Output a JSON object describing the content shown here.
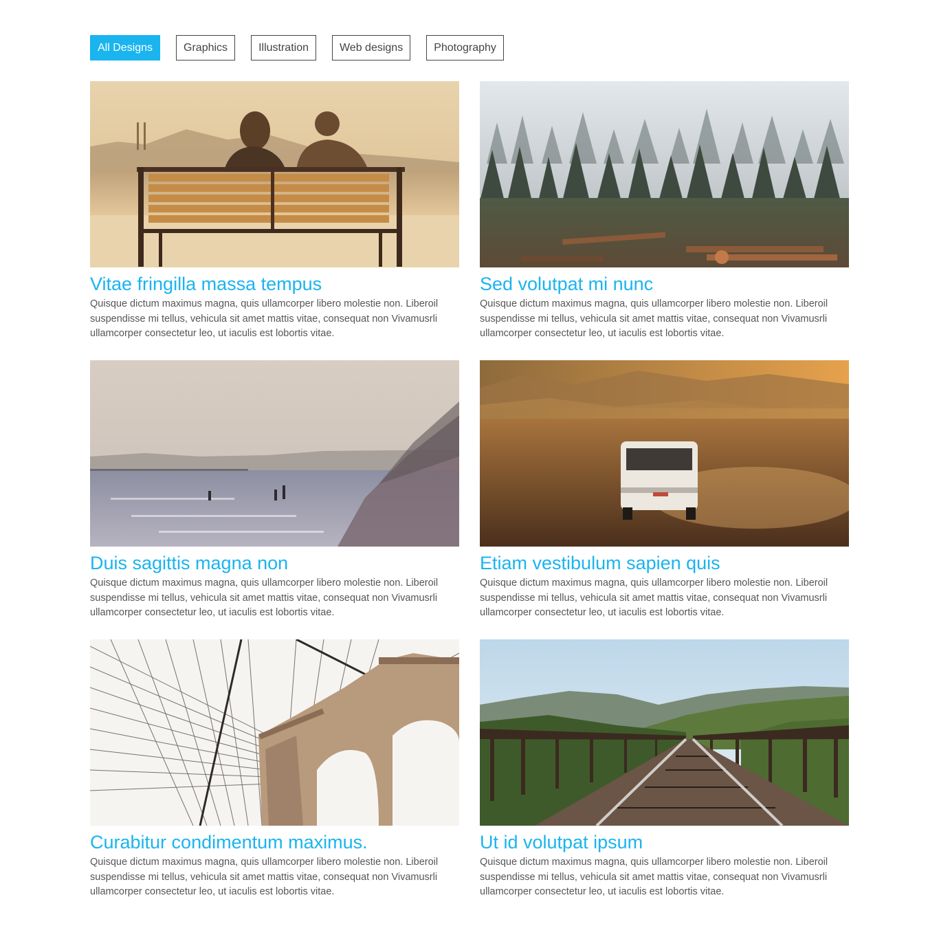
{
  "filters": [
    {
      "label": "All Designs",
      "active": true
    },
    {
      "label": "Graphics",
      "active": false
    },
    {
      "label": "Illustration",
      "active": false
    },
    {
      "label": "Web designs",
      "active": false
    },
    {
      "label": "Photography",
      "active": false
    }
  ],
  "colors": {
    "accent": "#1ab4ef",
    "text": "#555555",
    "border": "#444444"
  },
  "cards": [
    {
      "title": "Vitae fringilla massa tempus",
      "text": "Quisque dictum maximus magna, quis ullamcorper libero molestie non. Liberoil suspendisse mi tellus, vehicula sit amet mattis vitae, consequat non Vivamusrli ullamcorper consectetur leo, ut iaculis est lobortis vitae.",
      "image": "couple-on-bench-photo"
    },
    {
      "title": "Sed volutpat mi nunc",
      "text": "Quisque dictum maximus magna, quis ullamcorper libero molestie non. Liberoil suspendisse mi tellus, vehicula sit amet mattis vitae, consequat non Vivamusrli ullamcorper consectetur leo, ut iaculis est lobortis vitae.",
      "image": "foggy-forest-photo"
    },
    {
      "title": "Duis sagittis magna non",
      "text": "Quisque dictum maximus magna, quis ullamcorper libero molestie non. Liberoil suspendisse mi tellus, vehicula sit amet mattis vitae, consequat non Vivamusrli ullamcorper consectetur leo, ut iaculis est lobortis vitae.",
      "image": "misty-beach-photo"
    },
    {
      "title": "Etiam vestibulum sapien quis",
      "text": "Quisque dictum maximus magna, quis ullamcorper libero molestie non. Liberoil suspendisse mi tellus, vehicula sit amet mattis vitae, consequat non Vivamusrli ullamcorper consectetur leo, ut iaculis est lobortis vitae.",
      "image": "van-in-desert-photo"
    },
    {
      "title": "Curabitur condimentum maximus.",
      "text": "Quisque dictum maximus magna, quis ullamcorper libero molestie non. Liberoil suspendisse mi tellus, vehicula sit amet mattis vitae, consequat non Vivamusrli ullamcorper consectetur leo, ut iaculis est lobortis vitae.",
      "image": "suspension-bridge-photo"
    },
    {
      "title": "Ut id volutpat ipsum",
      "text": "Quisque dictum maximus magna, quis ullamcorper libero molestie non. Liberoil suspendisse mi tellus, vehicula sit amet mattis vitae, consequat non Vivamusrli ullamcorper consectetur leo, ut iaculis est lobortis vitae.",
      "image": "railway-bridge-photo"
    }
  ]
}
